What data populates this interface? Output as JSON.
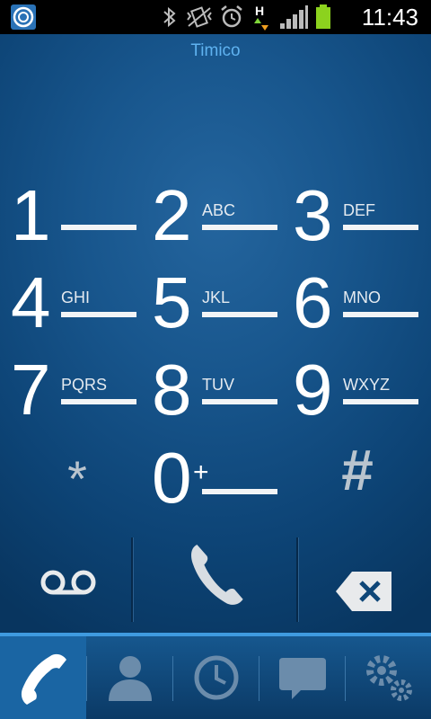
{
  "status_bar": {
    "time": "11:43",
    "network_label": "H",
    "icons": [
      "app-icon",
      "bluetooth-icon",
      "vibrate-icon",
      "alarm-icon",
      "data-activity-icon",
      "signal-icon",
      "battery-icon"
    ]
  },
  "carrier": "Timico",
  "keypad": [
    {
      "digit": "1",
      "letters": ""
    },
    {
      "digit": "2",
      "letters": "ABC"
    },
    {
      "digit": "3",
      "letters": "DEF"
    },
    {
      "digit": "4",
      "letters": "GHI"
    },
    {
      "digit": "5",
      "letters": "JKL"
    },
    {
      "digit": "6",
      "letters": "MNO"
    },
    {
      "digit": "7",
      "letters": "PQRS"
    },
    {
      "digit": "8",
      "letters": "TUV"
    },
    {
      "digit": "9",
      "letters": "WXYZ"
    },
    {
      "digit": "*",
      "letters": ""
    },
    {
      "digit": "0",
      "letters": "+"
    },
    {
      "digit": "#",
      "letters": ""
    }
  ],
  "actions": [
    "voicemail-icon",
    "call-icon",
    "backspace-icon"
  ],
  "tabs": [
    {
      "name": "phone",
      "icon": "phone-icon",
      "active": true
    },
    {
      "name": "contacts",
      "icon": "contact-icon",
      "active": false
    },
    {
      "name": "logs",
      "icon": "clock-icon",
      "active": false
    },
    {
      "name": "messages",
      "icon": "message-icon",
      "active": false
    },
    {
      "name": "settings",
      "icon": "gears-icon",
      "active": false
    }
  ],
  "colors": {
    "background": "#0b3f6c",
    "carrier_text": "#5fb2f0",
    "tab_accent": "#3f9be0",
    "battery": "#8cd21e"
  }
}
